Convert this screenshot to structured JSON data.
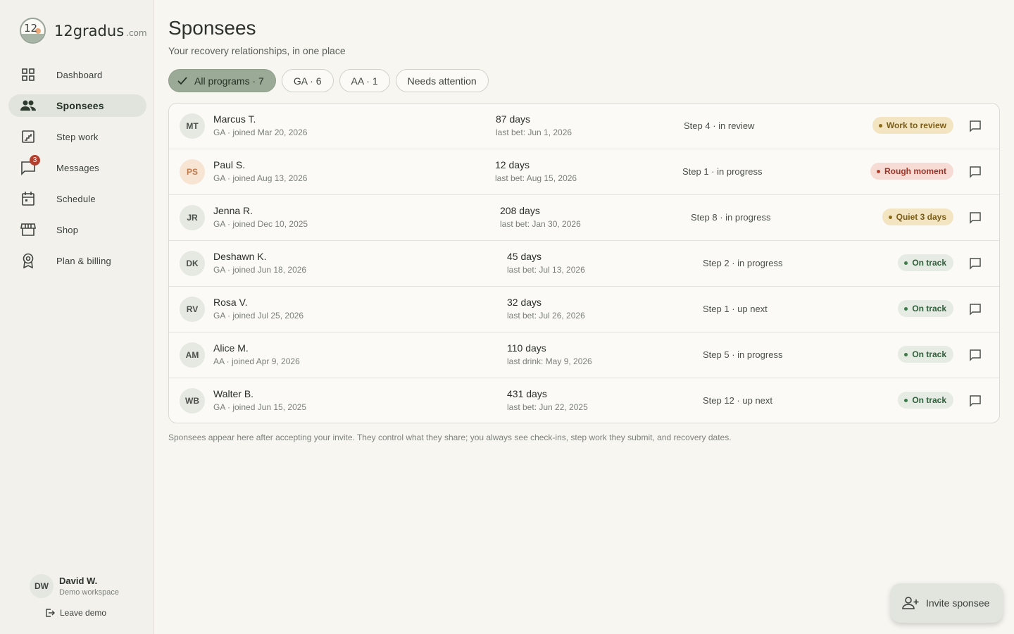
{
  "brand": {
    "logo_text": "12",
    "name": "12gradus",
    "suffix": ".com"
  },
  "nav": [
    {
      "label": "Dashboard",
      "icon": "dashboard-icon"
    },
    {
      "label": "Sponsees",
      "icon": "people-icon",
      "active": true
    },
    {
      "label": "Step work",
      "icon": "stairs-icon"
    },
    {
      "label": "Messages",
      "icon": "chat-icon",
      "badge": "3"
    },
    {
      "label": "Schedule",
      "icon": "calendar-icon"
    },
    {
      "label": "Shop",
      "icon": "store-icon"
    },
    {
      "label": "Plan & billing",
      "icon": "badge-icon"
    }
  ],
  "user": {
    "initials": "DW",
    "name": "David W.",
    "workspace": "Demo workspace",
    "leave_label": "Leave demo"
  },
  "page": {
    "title": "Sponsees",
    "subtitle": "Your recovery relationships, in one place"
  },
  "filters": [
    {
      "label": "All programs · 7",
      "selected": true
    },
    {
      "label": "GA · 6"
    },
    {
      "label": "AA · 1"
    },
    {
      "label": "Needs attention"
    }
  ],
  "sponsees": [
    {
      "initials": "MT",
      "name": "Marcus T.",
      "meta": "GA · joined Mar 20, 2026",
      "days": "87 days",
      "last": "last bet: Jun 1, 2026",
      "step": "Step 4 · in review",
      "status": "Work to review",
      "status_kind": "review"
    },
    {
      "initials": "PS",
      "name": "Paul S.",
      "meta": "GA · joined Aug 13, 2026",
      "days": "12 days",
      "last": "last bet: Aug 15, 2026",
      "step": "Step 1 · in progress",
      "status": "Rough moment",
      "status_kind": "rough"
    },
    {
      "initials": "JR",
      "name": "Jenna R.",
      "meta": "GA · joined Dec 10, 2025",
      "days": "208 days",
      "last": "last bet: Jan 30, 2026",
      "step": "Step 8 · in progress",
      "status": "Quiet 3 days",
      "status_kind": "quiet"
    },
    {
      "initials": "DK",
      "name": "Deshawn K.",
      "meta": "GA · joined Jun 18, 2026",
      "days": "45 days",
      "last": "last bet: Jul 13, 2026",
      "step": "Step 2 · in progress",
      "status": "On track",
      "status_kind": "ontrack"
    },
    {
      "initials": "RV",
      "name": "Rosa V.",
      "meta": "GA · joined Jul 25, 2026",
      "days": "32 days",
      "last": "last bet: Jul 26, 2026",
      "step": "Step 1 · up next",
      "status": "On track",
      "status_kind": "ontrack"
    },
    {
      "initials": "AM",
      "name": "Alice M.",
      "meta": "AA · joined Apr 9, 2026",
      "days": "110 days",
      "last": "last drink: May 9, 2026",
      "step": "Step 5 · in progress",
      "status": "On track",
      "status_kind": "ontrack"
    },
    {
      "initials": "WB",
      "name": "Walter B.",
      "meta": "GA · joined Jun 15, 2025",
      "days": "431 days",
      "last": "last bet: Jun 22, 2025",
      "step": "Step 12 · up next",
      "status": "On track",
      "status_kind": "ontrack"
    }
  ],
  "footnote": "Sponsees appear here after accepting your invite. They control what they share; you always see check-ins, step work they submit, and recovery dates.",
  "fab": {
    "label": "Invite sponsee",
    "icon": "person-add-icon"
  },
  "colors": {
    "accent": "#9aaa97",
    "sidebar_bg": "#f2f1ec",
    "page_bg": "#f7f6f1",
    "alert": "#b3402f"
  }
}
